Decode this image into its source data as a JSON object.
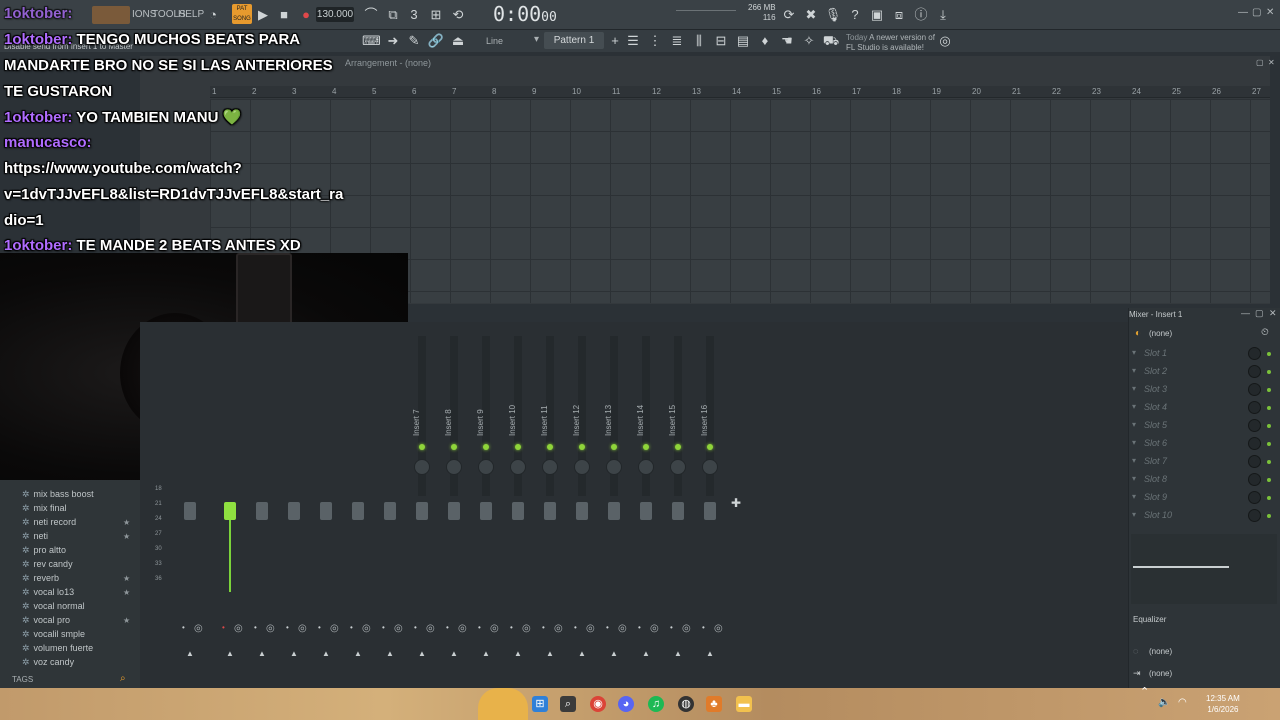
{
  "menu": {
    "tools": "TOOLS",
    "help": "HELP",
    "options": "IONS"
  },
  "transport": {
    "tempo": "130.000",
    "time": "0:00",
    "time_small": "00",
    "pat": "PAT",
    "song": "SONG"
  },
  "cpu": {
    "mem": "266 MB",
    "val": "116"
  },
  "toolbar2": {
    "pattern": "Pattern 1",
    "line_mode": "Line",
    "news_date": "Today",
    "news_line1": "A newer version of",
    "news_line2": "FL Studio is available!",
    "hint": "Disable send from Insert 1 to Master"
  },
  "arrangement": {
    "title": "Arrangement - (none)",
    "ruler": [
      "1",
      "2",
      "3",
      "4",
      "5",
      "6",
      "7",
      "8",
      "9",
      "10",
      "11",
      "12",
      "13",
      "14",
      "15",
      "16",
      "17",
      "18",
      "19",
      "20",
      "21",
      "22",
      "23",
      "24",
      "25",
      "26",
      "27"
    ]
  },
  "browser": {
    "items": [
      {
        "label": "mix bass boost",
        "star": false
      },
      {
        "label": "mix final",
        "star": false
      },
      {
        "label": "neti record",
        "star": true
      },
      {
        "label": "neti",
        "star": true
      },
      {
        "label": "pro altto",
        "star": false
      },
      {
        "label": "rev candy",
        "star": false
      },
      {
        "label": "reverb",
        "star": true
      },
      {
        "label": "vocal lo13",
        "star": true
      },
      {
        "label": "vocal normal",
        "star": false
      },
      {
        "label": "vocal pro",
        "star": true
      },
      {
        "label": "vocalil smple",
        "star": false
      },
      {
        "label": "volumen fuerte",
        "star": false
      },
      {
        "label": "voz candy",
        "star": false
      }
    ],
    "tags": "TAGS"
  },
  "mixer": {
    "inserts": [
      "Insert 7",
      "Insert 8",
      "Insert 9",
      "Insert 10",
      "Insert 11",
      "Insert 12",
      "Insert 13",
      "Insert 14",
      "Insert 15",
      "Insert 16"
    ],
    "scale": [
      "18",
      "21",
      "24",
      "27",
      "30",
      "33",
      "36"
    ]
  },
  "mixpanel": {
    "title": "Mixer - Insert 1",
    "preset": "(none)",
    "slots": [
      "Slot 1",
      "Slot 2",
      "Slot 3",
      "Slot 4",
      "Slot 5",
      "Slot 6",
      "Slot 7",
      "Slot 8",
      "Slot 9",
      "Slot 10"
    ],
    "eq_label": "Equalizer",
    "out1": "(none)",
    "out2": "(none)"
  },
  "chat": [
    {
      "user": "1oktober:",
      "text": " TENGO MUCHOS BEATS PARA"
    },
    {
      "user": "",
      "text": "MANDARTE BRO NO SE SI LAS ANTERIORES"
    },
    {
      "user": "",
      "text": "TE GUSTARON"
    },
    {
      "user": "1oktober:",
      "text": " YO TAMBIEN MANU 💚"
    },
    {
      "user": "manucasco:",
      "text": ""
    },
    {
      "user": "",
      "text": "https://www.youtube.com/watch?"
    },
    {
      "user": "",
      "text": "v=1dvTJJvEFL8&list=RD1dvTJJvEFL8&start_ra"
    },
    {
      "user": "",
      "text": "dio=1"
    },
    {
      "user": "1oktober:",
      "text": " TE MANDE 2 BEATS ANTES XD"
    }
  ],
  "chat_top_user": "1oktober:",
  "clock": {
    "time": "12:35 AM",
    "date": "1/6/2026"
  }
}
